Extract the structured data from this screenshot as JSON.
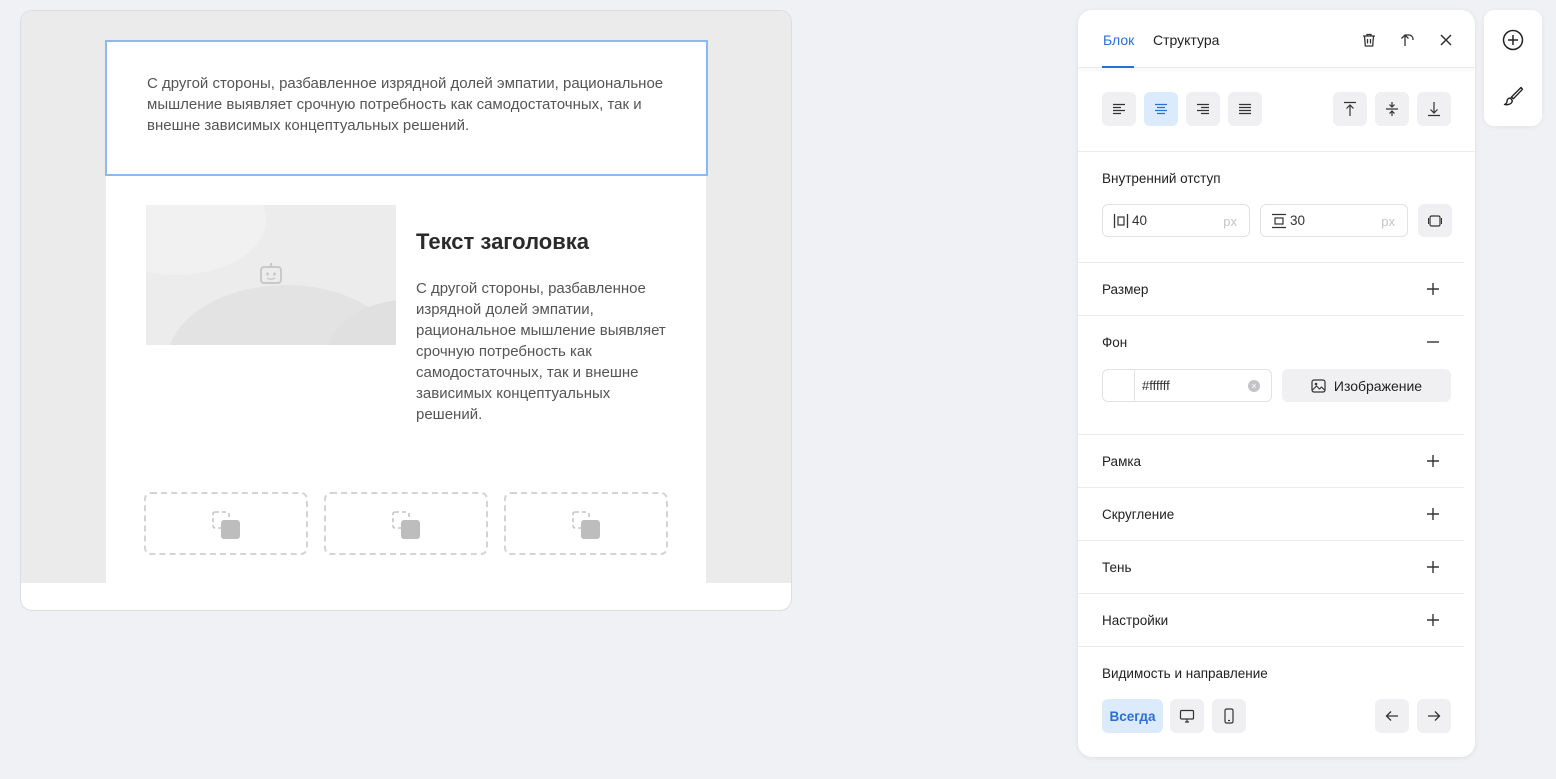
{
  "canvas": {
    "text_block": "С другой стороны, разбавленное изрядной долей эмпатии, рациональное мышление выявляет срочную потребность как самодостаточных, так и внешне зависимых концептуальных решений.",
    "heading": "Текст заголовка",
    "body_text": "С другой стороны, разбавленное изрядной долей эмпатии, рациональное мышление выявляет срочную потребность как самодостаточных, так и внешне зависимых концептуальных решений.",
    "image_placeholder_icon": "image-placeholder-icon",
    "slot_icon": "add-element-icon"
  },
  "panel": {
    "tabs": [
      {
        "label": "Блок",
        "active": true
      },
      {
        "label": "Структура",
        "active": false
      }
    ],
    "header_icons": [
      "trash-icon",
      "select-parent-icon",
      "close-icon"
    ],
    "align": {
      "horizontal": [
        "align-left-icon",
        "align-center-icon",
        "align-right-icon",
        "align-justify-icon"
      ],
      "horizontal_active": "center",
      "vertical": [
        "align-top-icon",
        "align-middle-icon",
        "align-bottom-icon"
      ]
    },
    "padding": {
      "title": "Внутренний отступ",
      "horizontal": "40",
      "vertical": "30",
      "unit": "px"
    },
    "size": {
      "title": "Размер"
    },
    "background": {
      "title": "Фон",
      "color": "#ffffff",
      "image_label": "Изображение"
    },
    "border": {
      "title": "Рамка"
    },
    "radius": {
      "title": "Скругление"
    },
    "shadow": {
      "title": "Тень"
    },
    "settings": {
      "title": "Настройки"
    },
    "visibility": {
      "title": "Видимость и направление",
      "always_label": "Всегда"
    }
  },
  "colors": {
    "accent": "#2a6fd6",
    "accent_bg": "#dcebfc",
    "selection": "#8cb9ef"
  },
  "side_tools": [
    "add-icon",
    "brush-icon"
  ]
}
